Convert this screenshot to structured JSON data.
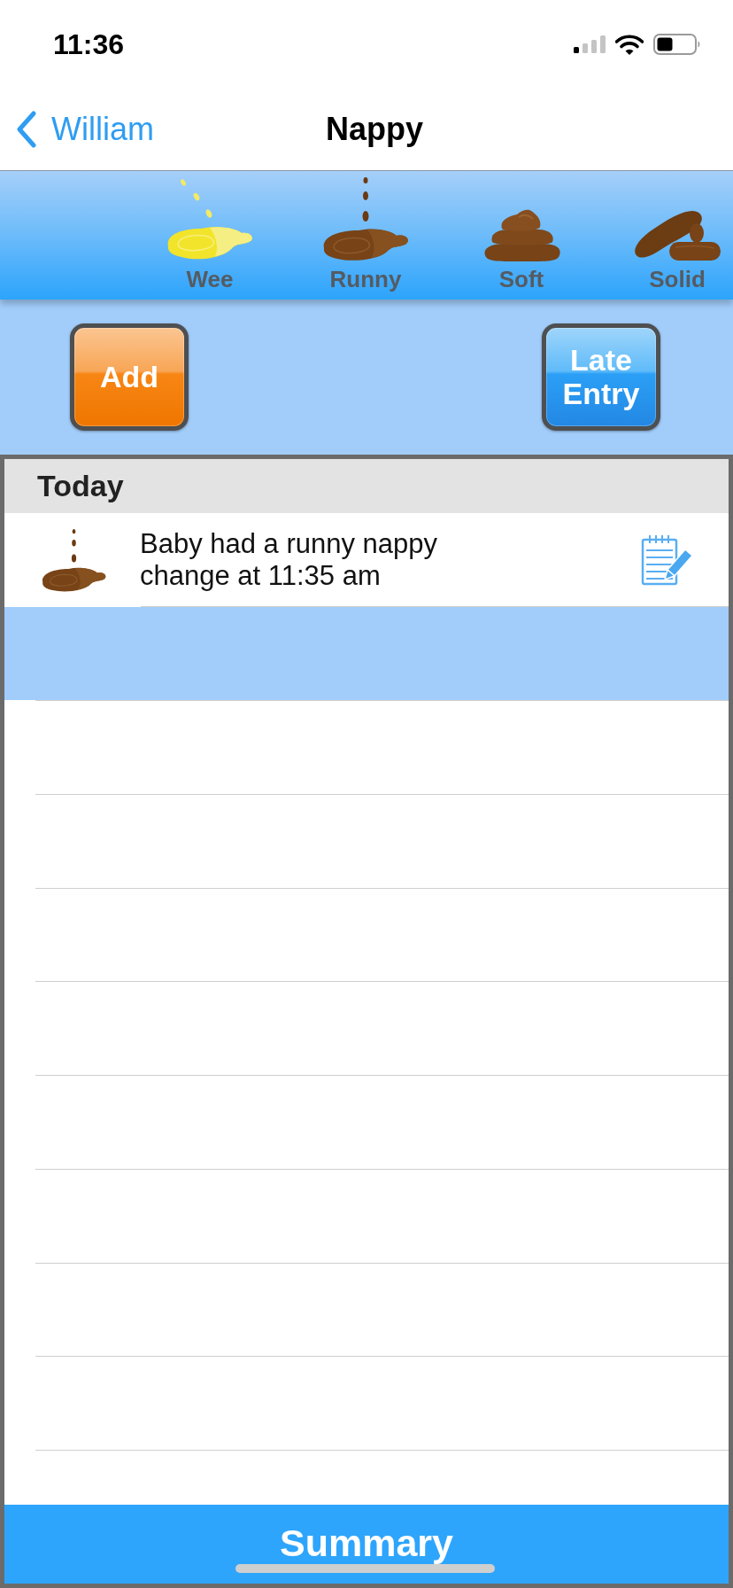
{
  "status_bar": {
    "time": "11:36"
  },
  "nav": {
    "back_label": "William",
    "title": "Nappy"
  },
  "nappy_types": [
    {
      "kind": "wee",
      "label": "Wee"
    },
    {
      "kind": "runny",
      "label": "Runny"
    },
    {
      "kind": "soft",
      "label": "Soft"
    },
    {
      "kind": "solid",
      "label": "Solid"
    }
  ],
  "actions": {
    "add": {
      "label": "Add"
    },
    "late_entry": {
      "label": "Late Entry"
    }
  },
  "log": {
    "sections": [
      {
        "title": "Today",
        "entries": [
          {
            "kind": "runny",
            "text": "Baby had a runny nappy change at 11:35 am"
          }
        ]
      }
    ]
  },
  "footer": {
    "label": "Summary"
  }
}
